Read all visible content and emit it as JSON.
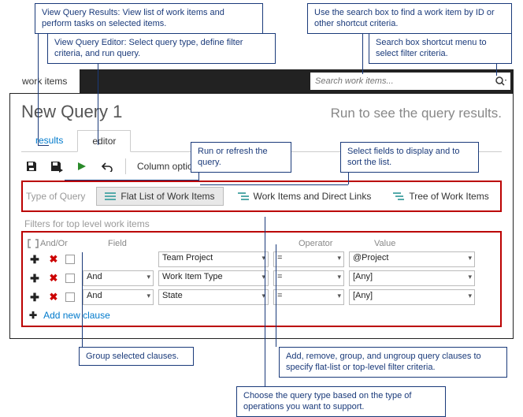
{
  "callouts": {
    "c1": "View Query Results: View list of work items and perform tasks on selected items.",
    "c2": "View Query Editor: Select query type, define filter criteria, and run query.",
    "c3": "Use the search box to find a work item by ID or other shortcut criteria.",
    "c4": "Search box shortcut menu to select filter criteria.",
    "c5": "Run or refresh the query.",
    "c6": "Select fields to display and to sort the list.",
    "c7": "Group selected clauses.",
    "c8": "Add, remove, group, and ungroup query clauses to specify flat-list or top-level filter criteria.",
    "c9": "Choose the query type based on the type of operations you want to support."
  },
  "hub": {
    "tab": "work items"
  },
  "search": {
    "placeholder": "Search work items..."
  },
  "title": "New Query 1",
  "runmsg": "Run to see the query results.",
  "views": {
    "results": "results",
    "editor": "editor"
  },
  "toolbar": {
    "colopt": "Column options"
  },
  "qtype": {
    "label": "Type of Query",
    "flat": "Flat List of Work Items",
    "links": "Work Items and Direct Links",
    "tree": "Tree of Work Items"
  },
  "filters": {
    "label": "Filters for top level work items",
    "headers": {
      "andor": "And/Or",
      "field": "Field",
      "op": "Operator",
      "value": "Value"
    },
    "rows": [
      {
        "andor": "",
        "field": "Team Project",
        "op": "=",
        "value": "@Project"
      },
      {
        "andor": "And",
        "field": "Work Item Type",
        "op": "=",
        "value": "[Any]"
      },
      {
        "andor": "And",
        "field": "State",
        "op": "=",
        "value": "[Any]"
      }
    ],
    "add": "Add new clause"
  }
}
